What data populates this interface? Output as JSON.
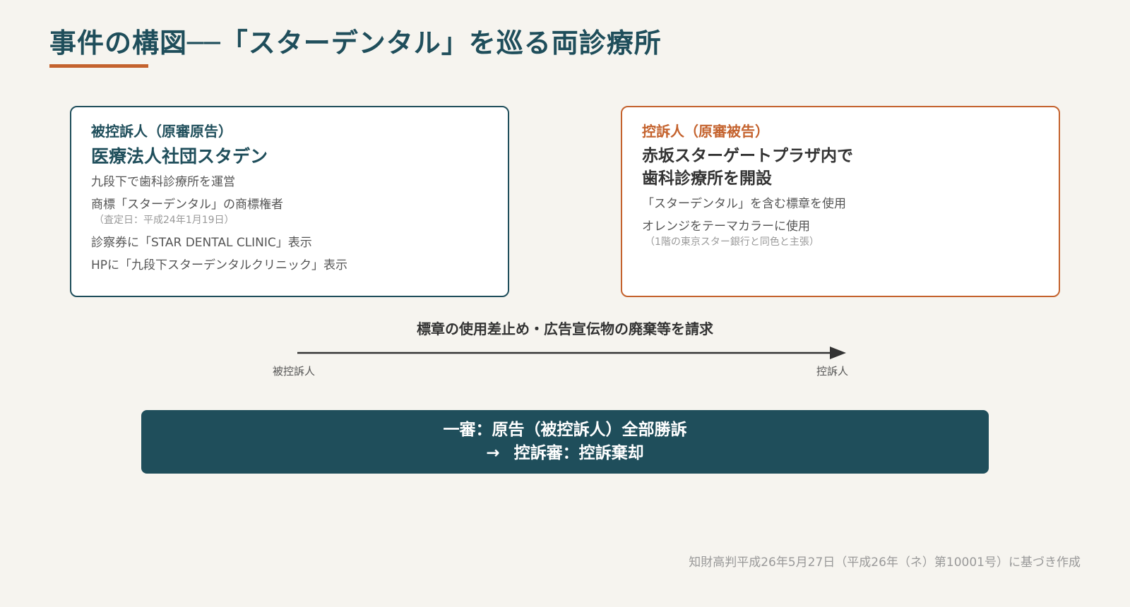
{
  "title": "事件の構図──「スターデンタル」を巡る両診療所",
  "appellee": {
    "role": "被控訴人（原審原告）",
    "name": "医療法人社団スタデン",
    "line1": "九段下で歯科診療所を運営",
    "line2": "商標「スターデンタル」の商標権者",
    "note": "（査定日：平成24年1月19日）",
    "line3": "診察券に「STAR DENTAL CLINIC」表示",
    "line4": "HPに「九段下スターデンタルクリニック」表示"
  },
  "appellant": {
    "role": "控訴人（原審被告）",
    "name_line1": "赤坂スターゲートプラザ内で",
    "name_line2": "歯科診療所を開設",
    "line1": "「スターデンタル」を含む標章を使用",
    "line2": "オレンジをテーマカラーに使用",
    "note": "（1階の東京スター銀行と同色と主張）"
  },
  "arrow": {
    "label": "標章の使用差止め・広告宣伝物の廃棄等を請求",
    "from_label": "被控訴人",
    "to_label": "控訴人"
  },
  "result": {
    "line1": "一審：原告（被控訴人）全部勝訴",
    "arrow_symbol": "→",
    "line2": "控訴審：控訴棄却"
  },
  "source": "知財高判平成26年5月27日（平成26年（ネ）第10001号）に基づき作成",
  "colors": {
    "primary": "#1f4e5b",
    "accent": "#c4622d",
    "background": "#f6f4ef"
  }
}
